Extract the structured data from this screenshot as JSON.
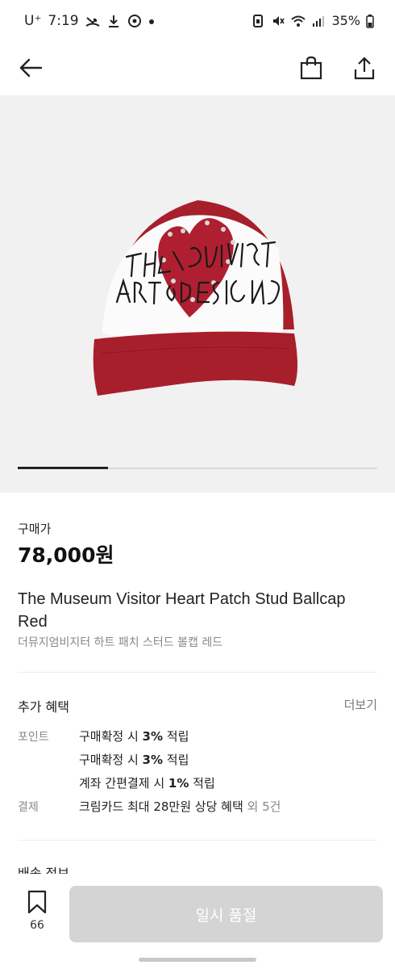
{
  "status_bar": {
    "carrier": "U⁺",
    "time": "7:19",
    "battery": "35%"
  },
  "nav": {
    "back_icon": "arrow-left-icon",
    "bag_icon": "shopping-bag-icon",
    "share_icon": "share-icon"
  },
  "gallery": {
    "progress_fraction": 0.25,
    "image_text": [
      "THE MUSEUM VISITOR",
      "ART & DESIGN STUDIO"
    ]
  },
  "product": {
    "price_label": "구매가",
    "price": "78,000원",
    "title_en": "The Museum Visitor Heart Patch Stud Ballcap Red",
    "title_ko": "더뮤지엄비지터 하트 패치 스터드 볼캡 레드"
  },
  "benefits": {
    "title": "추가 혜택",
    "more": "더보기",
    "point_label": "포인트",
    "point_rows": [
      {
        "pre": "구매확정 시 ",
        "bold": "3%",
        "post": " 적립"
      },
      {
        "pre": "구매확정 시 ",
        "bold": "3%",
        "post": " 적립"
      },
      {
        "pre": "계좌 간편결제 시 ",
        "bold": "1%",
        "post": " 적립"
      }
    ],
    "payment_label": "결제",
    "payment_text": "크림카드 최대 28만원 상당 혜택",
    "payment_extra": " 외 5건"
  },
  "shipping": {
    "title": "배송 정보"
  },
  "bottom": {
    "wish_count": "66",
    "buy_label": "일시 품절"
  },
  "colors": {
    "cap_red": "#a81f2c",
    "button_disabled": "#d4d4d4"
  }
}
